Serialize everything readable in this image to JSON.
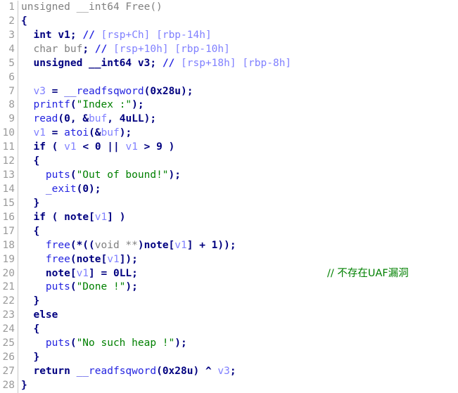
{
  "view": {
    "name": "hex-rays-pseudocode",
    "background": "#ffffff",
    "gutter_color": "#9a9a9a",
    "gutter_rule_color": "#c8c8c8"
  },
  "palette": {
    "plain": "#000000",
    "gray": "#808080",
    "keyword": "#000080",
    "function": "#2424e0",
    "global_var": "#000080",
    "local_var": "#8080ff",
    "string": "#008000",
    "comment": "#008000",
    "stack_comment": "#8080ff"
  },
  "code": {
    "first_line_number": 1,
    "last_line_number": 28,
    "lines": [
      {
        "n": "1",
        "tokens": [
          {
            "c": "def",
            "t": "unsigned __int64 Free()"
          }
        ]
      },
      {
        "n": "2",
        "tokens": [
          {
            "c": "punct",
            "t": "{"
          }
        ]
      },
      {
        "n": "3",
        "tokens": [
          {
            "c": "plain",
            "t": "  "
          },
          {
            "c": "kw",
            "t": "int"
          },
          {
            "c": "plain",
            "t": " "
          },
          {
            "c": "gvar",
            "t": "v1"
          },
          {
            "c": "punct",
            "t": ";"
          },
          {
            "c": "plain",
            "t": " "
          },
          {
            "c": "slash",
            "t": "//"
          },
          {
            "c": "stkcmt",
            "t": " [rsp+Ch] [rbp-14h]"
          }
        ]
      },
      {
        "n": "4",
        "tokens": [
          {
            "c": "plain",
            "t": "  "
          },
          {
            "c": "kwgray",
            "t": "char"
          },
          {
            "c": "kwgray",
            "t": " "
          },
          {
            "c": "kwgray",
            "t": "buf"
          },
          {
            "c": "punct",
            "t": ";"
          },
          {
            "c": "plain",
            "t": " "
          },
          {
            "c": "slash",
            "t": "//"
          },
          {
            "c": "stkcmt",
            "t": " [rsp+10h] [rbp-10h]"
          }
        ]
      },
      {
        "n": "5",
        "tokens": [
          {
            "c": "plain",
            "t": "  "
          },
          {
            "c": "kw",
            "t": "unsigned __int64"
          },
          {
            "c": "plain",
            "t": " "
          },
          {
            "c": "gvar",
            "t": "v3"
          },
          {
            "c": "punct",
            "t": ";"
          },
          {
            "c": "plain",
            "t": " "
          },
          {
            "c": "slash",
            "t": "//"
          },
          {
            "c": "stkcmt",
            "t": " [rsp+18h] [rbp-8h]"
          }
        ]
      },
      {
        "n": "6",
        "tokens": []
      },
      {
        "n": "7",
        "tokens": [
          {
            "c": "plain",
            "t": "  "
          },
          {
            "c": "lvar",
            "t": "v3"
          },
          {
            "c": "punct",
            "t": " = "
          },
          {
            "c": "func",
            "t": "__readfsqword"
          },
          {
            "c": "punct",
            "t": "("
          },
          {
            "c": "num",
            "t": "0x28u"
          },
          {
            "c": "punct",
            "t": ");"
          }
        ]
      },
      {
        "n": "8",
        "tokens": [
          {
            "c": "plain",
            "t": "  "
          },
          {
            "c": "func",
            "t": "printf"
          },
          {
            "c": "punct",
            "t": "("
          },
          {
            "c": "str",
            "t": "\"Index :\""
          },
          {
            "c": "punct",
            "t": ");"
          }
        ]
      },
      {
        "n": "9",
        "tokens": [
          {
            "c": "plain",
            "t": "  "
          },
          {
            "c": "func",
            "t": "read"
          },
          {
            "c": "punct",
            "t": "("
          },
          {
            "c": "num",
            "t": "0"
          },
          {
            "c": "punct",
            "t": ", &"
          },
          {
            "c": "lvar",
            "t": "buf"
          },
          {
            "c": "punct",
            "t": ", "
          },
          {
            "c": "num",
            "t": "4uLL"
          },
          {
            "c": "punct",
            "t": ");"
          }
        ]
      },
      {
        "n": "10",
        "tokens": [
          {
            "c": "plain",
            "t": "  "
          },
          {
            "c": "lvar",
            "t": "v1"
          },
          {
            "c": "punct",
            "t": " = "
          },
          {
            "c": "func",
            "t": "atoi"
          },
          {
            "c": "punct",
            "t": "(&"
          },
          {
            "c": "lvar",
            "t": "buf"
          },
          {
            "c": "punct",
            "t": ");"
          }
        ]
      },
      {
        "n": "11",
        "tokens": [
          {
            "c": "plain",
            "t": "  "
          },
          {
            "c": "kw",
            "t": "if"
          },
          {
            "c": "punct",
            "t": " ( "
          },
          {
            "c": "lvar",
            "t": "v1"
          },
          {
            "c": "punct",
            "t": " < "
          },
          {
            "c": "num",
            "t": "0"
          },
          {
            "c": "punct",
            "t": " || "
          },
          {
            "c": "lvar",
            "t": "v1"
          },
          {
            "c": "punct",
            "t": " > "
          },
          {
            "c": "num",
            "t": "9"
          },
          {
            "c": "punct",
            "t": " )"
          }
        ]
      },
      {
        "n": "12",
        "tokens": [
          {
            "c": "plain",
            "t": "  "
          },
          {
            "c": "punct",
            "t": "{"
          }
        ]
      },
      {
        "n": "13",
        "tokens": [
          {
            "c": "plain",
            "t": "    "
          },
          {
            "c": "func",
            "t": "puts"
          },
          {
            "c": "punct",
            "t": "("
          },
          {
            "c": "str",
            "t": "\"Out of bound!\""
          },
          {
            "c": "punct",
            "t": ");"
          }
        ]
      },
      {
        "n": "14",
        "tokens": [
          {
            "c": "plain",
            "t": "    "
          },
          {
            "c": "func",
            "t": "_exit"
          },
          {
            "c": "punct",
            "t": "("
          },
          {
            "c": "num",
            "t": "0"
          },
          {
            "c": "punct",
            "t": ");"
          }
        ]
      },
      {
        "n": "15",
        "tokens": [
          {
            "c": "plain",
            "t": "  "
          },
          {
            "c": "punct",
            "t": "}"
          }
        ]
      },
      {
        "n": "16",
        "tokens": [
          {
            "c": "plain",
            "t": "  "
          },
          {
            "c": "kw",
            "t": "if"
          },
          {
            "c": "punct",
            "t": " ( "
          },
          {
            "c": "gvar",
            "t": "note"
          },
          {
            "c": "punct",
            "t": "["
          },
          {
            "c": "lvar",
            "t": "v1"
          },
          {
            "c": "punct",
            "t": "] )"
          }
        ]
      },
      {
        "n": "17",
        "tokens": [
          {
            "c": "plain",
            "t": "  "
          },
          {
            "c": "punct",
            "t": "{"
          }
        ]
      },
      {
        "n": "18",
        "tokens": [
          {
            "c": "plain",
            "t": "    "
          },
          {
            "c": "func",
            "t": "free"
          },
          {
            "c": "punct",
            "t": "(*(("
          },
          {
            "c": "kwgray",
            "t": "void"
          },
          {
            "c": "kwgray",
            "t": " **"
          },
          {
            "c": "punct",
            "t": ")"
          },
          {
            "c": "gvar",
            "t": "note"
          },
          {
            "c": "punct",
            "t": "["
          },
          {
            "c": "lvar",
            "t": "v1"
          },
          {
            "c": "punct",
            "t": "] + "
          },
          {
            "c": "num",
            "t": "1"
          },
          {
            "c": "punct",
            "t": "));"
          }
        ]
      },
      {
        "n": "19",
        "tokens": [
          {
            "c": "plain",
            "t": "    "
          },
          {
            "c": "func",
            "t": "free"
          },
          {
            "c": "punct",
            "t": "("
          },
          {
            "c": "gvar",
            "t": "note"
          },
          {
            "c": "punct",
            "t": "["
          },
          {
            "c": "lvar",
            "t": "v1"
          },
          {
            "c": "punct",
            "t": "]);"
          }
        ]
      },
      {
        "n": "20",
        "tokens": [
          {
            "c": "plain",
            "t": "    "
          },
          {
            "c": "gvar",
            "t": "note"
          },
          {
            "c": "punct",
            "t": "["
          },
          {
            "c": "lvar",
            "t": "v1"
          },
          {
            "c": "punct",
            "t": "] = "
          },
          {
            "c": "num",
            "t": "0LL"
          },
          {
            "c": "punct",
            "t": ";"
          }
        ],
        "trailing_comment": "// 不存在UAF漏洞",
        "trailing_comment_col": 465
      },
      {
        "n": "21",
        "tokens": [
          {
            "c": "plain",
            "t": "    "
          },
          {
            "c": "func",
            "t": "puts"
          },
          {
            "c": "punct",
            "t": "("
          },
          {
            "c": "str",
            "t": "\"Done !\""
          },
          {
            "c": "punct",
            "t": ");"
          }
        ]
      },
      {
        "n": "22",
        "tokens": [
          {
            "c": "plain",
            "t": "  "
          },
          {
            "c": "punct",
            "t": "}"
          }
        ]
      },
      {
        "n": "23",
        "tokens": [
          {
            "c": "plain",
            "t": "  "
          },
          {
            "c": "kw",
            "t": "else"
          }
        ]
      },
      {
        "n": "24",
        "tokens": [
          {
            "c": "plain",
            "t": "  "
          },
          {
            "c": "punct",
            "t": "{"
          }
        ]
      },
      {
        "n": "25",
        "tokens": [
          {
            "c": "plain",
            "t": "    "
          },
          {
            "c": "func",
            "t": "puts"
          },
          {
            "c": "punct",
            "t": "("
          },
          {
            "c": "str",
            "t": "\"No such heap !\""
          },
          {
            "c": "punct",
            "t": ");"
          }
        ]
      },
      {
        "n": "26",
        "tokens": [
          {
            "c": "plain",
            "t": "  "
          },
          {
            "c": "punct",
            "t": "}"
          }
        ]
      },
      {
        "n": "27",
        "tokens": [
          {
            "c": "plain",
            "t": "  "
          },
          {
            "c": "kw",
            "t": "return"
          },
          {
            "c": "plain",
            "t": " "
          },
          {
            "c": "func",
            "t": "__readfsqword"
          },
          {
            "c": "punct",
            "t": "("
          },
          {
            "c": "num",
            "t": "0x28u"
          },
          {
            "c": "punct",
            "t": ") ^ "
          },
          {
            "c": "lvar",
            "t": "v3"
          },
          {
            "c": "punct",
            "t": ";"
          }
        ]
      },
      {
        "n": "28",
        "tokens": [
          {
            "c": "punct",
            "t": "}"
          }
        ]
      }
    ]
  }
}
